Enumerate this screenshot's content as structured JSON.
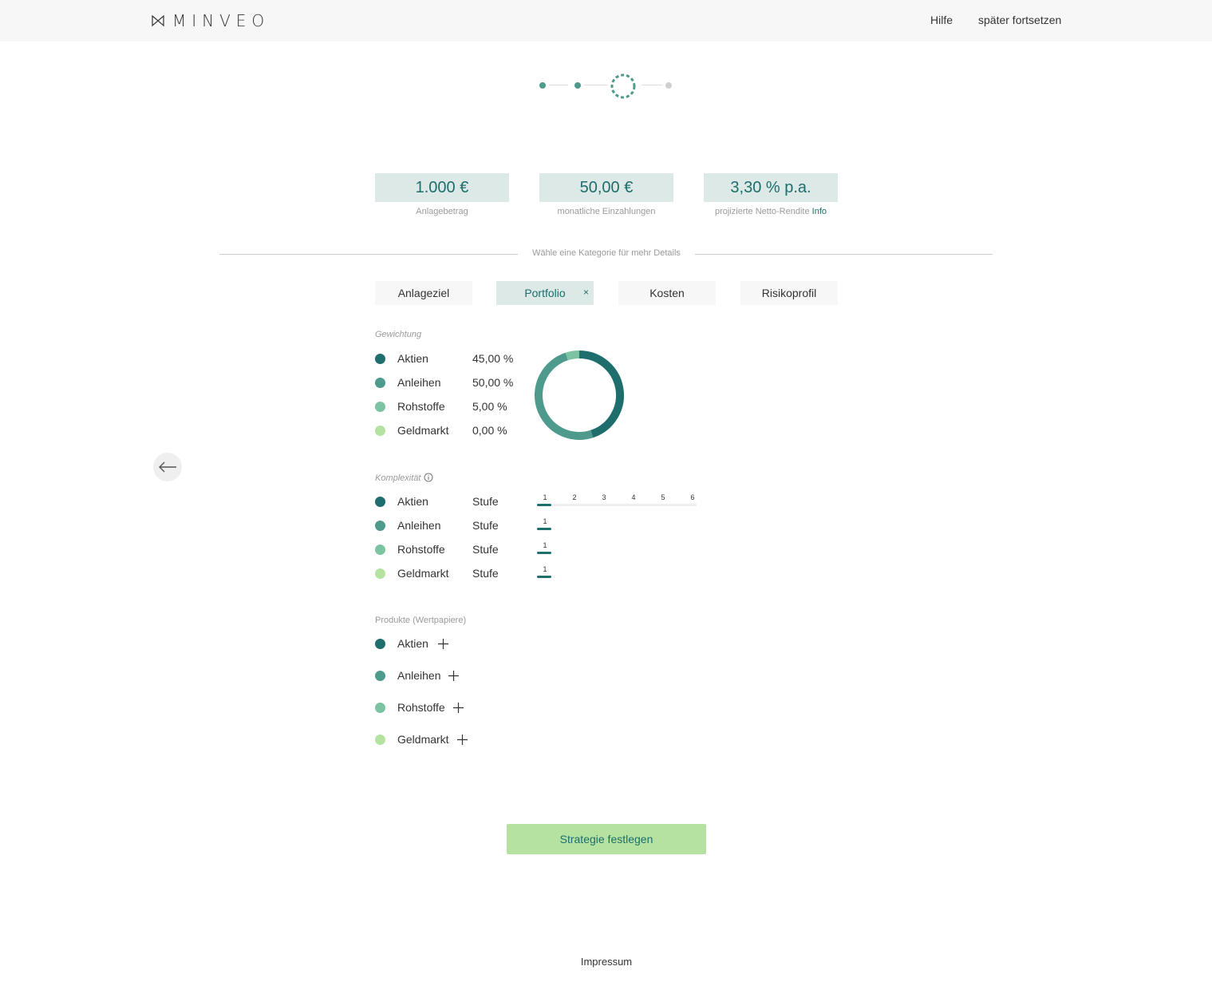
{
  "header": {
    "logo_text": "MINVEO",
    "help": "Hilfe",
    "later": "später fortsetzen"
  },
  "stepper": {
    "total_steps": 4,
    "current_step": 3
  },
  "summary": [
    {
      "value": "1.000 €",
      "label": "Anlagebetrag"
    },
    {
      "value": "50,00 €",
      "label": "monatliche Einzahlungen"
    },
    {
      "value": "3,30 % p.a.",
      "label": "projizierte Netto-Rendite",
      "info": "Info"
    }
  ],
  "divider_text": "Wähle eine Kategorie für mehr Details",
  "tabs": [
    {
      "label": "Anlageziel"
    },
    {
      "label": "Portfolio",
      "close": "×"
    },
    {
      "label": "Kosten"
    },
    {
      "label": "Risikoprofil"
    }
  ],
  "gewichtung": {
    "title": "Gewichtung",
    "rows": [
      {
        "label": "Aktien",
        "value": "45,00 %",
        "color": "#1d6e6c"
      },
      {
        "label": "Anleihen",
        "value": "50,00 %",
        "color": "#4e9a8c"
      },
      {
        "label": "Rohstoffe",
        "value": "5,00 %",
        "color": "#7cc3a2"
      },
      {
        "label": "Geldmarkt",
        "value": "0,00 %",
        "color": "#b5e2a1"
      }
    ]
  },
  "chart_data": {
    "type": "pie",
    "categories": [
      "Aktien",
      "Anleihen",
      "Rohstoffe",
      "Geldmarkt"
    ],
    "values": [
      45,
      50,
      5,
      0
    ],
    "colors": [
      "#1d6e6c",
      "#4e9a8c",
      "#7cc3a2",
      "#b5e2a1"
    ]
  },
  "komplexitaet": {
    "title": "Komplexität",
    "scale": [
      "1",
      "2",
      "3",
      "4",
      "5",
      "6"
    ],
    "rows": [
      {
        "label": "Aktien",
        "stufe": "Stufe",
        "level": "1",
        "color": "#1d6e6c"
      },
      {
        "label": "Anleihen",
        "stufe": "Stufe",
        "level": "1",
        "color": "#4e9a8c"
      },
      {
        "label": "Rohstoffe",
        "stufe": "Stufe",
        "level": "1",
        "color": "#7cc3a2"
      },
      {
        "label": "Geldmarkt",
        "stufe": "Stufe",
        "level": "1",
        "color": "#b5e2a1"
      }
    ]
  },
  "produkte": {
    "title": "Produkte (Wertpapiere)",
    "rows": [
      {
        "label": "Aktien",
        "color": "#1d6e6c"
      },
      {
        "label": "Anleihen",
        "color": "#4e9a8c"
      },
      {
        "label": "Rohstoffe",
        "color": "#7cc3a2"
      },
      {
        "label": "Geldmarkt",
        "color": "#b5e2a1"
      }
    ]
  },
  "cta": "Strategie festlegen",
  "footer": {
    "impressum": "Impressum"
  }
}
